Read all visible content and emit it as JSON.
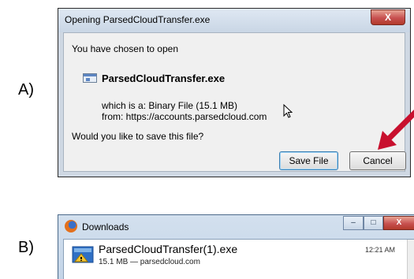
{
  "labels": {
    "a": "A)",
    "b": "B)"
  },
  "dialog": {
    "title": "Opening ParsedCloudTransfer.exe",
    "close_symbol": "X",
    "intro": "You have chosen to open",
    "file_name": "ParsedCloudTransfer.exe",
    "type_line": "which is a:  Binary File (15.1 MB)",
    "from_line": "from:  https://accounts.parsedcloud.com",
    "question": "Would you like to save this file?",
    "save_label": "Save File",
    "cancel_label": "Cancel",
    "arrow_color": "#c8102e"
  },
  "downloads": {
    "title": "Downloads",
    "minimize_symbol": "–",
    "maximize_symbol": "□",
    "close_symbol": "X",
    "file_name": "ParsedCloudTransfer(1).exe",
    "meta": "15.1 MB — parsedcloud.com",
    "time": "12:21 AM"
  }
}
